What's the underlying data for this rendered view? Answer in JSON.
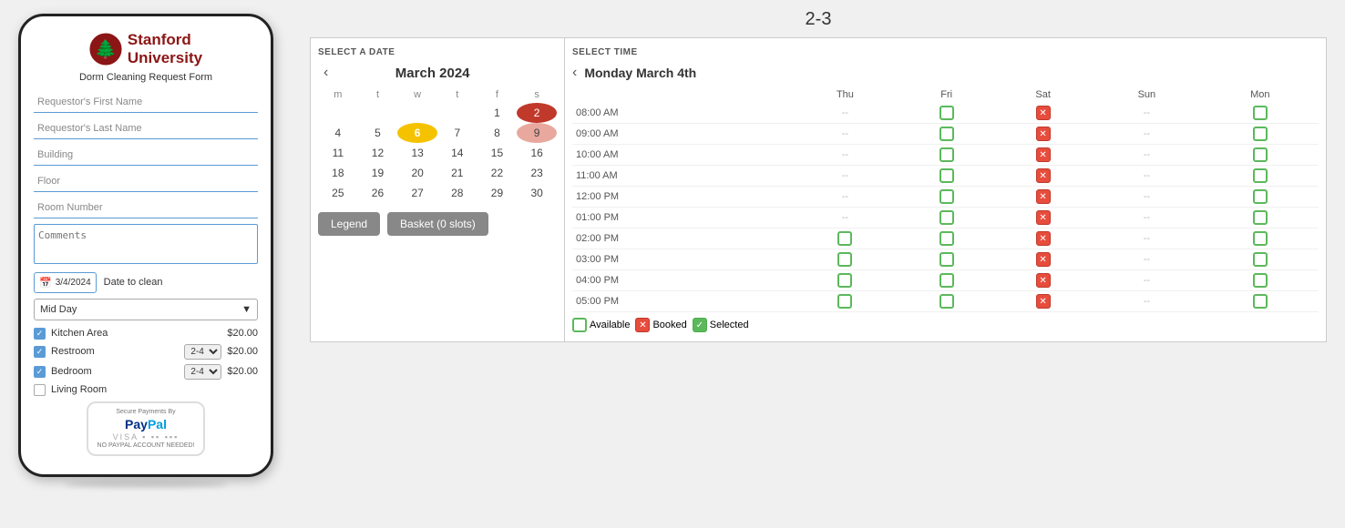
{
  "page": {
    "top_label": "2-3"
  },
  "phone": {
    "university_name": "Stanford\nUniversity",
    "form_title": "Dorm Cleaning Request Form",
    "fields": {
      "first_name_placeholder": "Requestor's First Name",
      "last_name_placeholder": "Requestor's Last Name",
      "building_placeholder": "Building",
      "floor_placeholder": "Floor",
      "room_placeholder": "Room Number",
      "comments_placeholder": "Comments"
    },
    "date_value": "3/4/2024",
    "date_label": "Date to clean",
    "dropdown_value": "Mid Day",
    "checkboxes": [
      {
        "label": "Kitchen Area",
        "checked": true,
        "has_select": false,
        "price": "$20.00"
      },
      {
        "label": "Restroom",
        "checked": true,
        "has_select": true,
        "select_val": "2-4",
        "price": "$20.00"
      },
      {
        "label": "Bedroom",
        "checked": true,
        "has_select": true,
        "select_val": "2-4",
        "price": "$20.00"
      },
      {
        "label": "Living Room",
        "checked": false,
        "has_select": false,
        "price": ""
      }
    ],
    "paypal": {
      "top_text": "Secure Payments By",
      "logo_text": "PayPal",
      "cards_text": "VISA ◼ ◼ ◼",
      "bottom_text": "NO PAYPAL ACCOUNT NEEDED!"
    }
  },
  "calendar": {
    "section_label": "SELECT A DATE",
    "month": "March 2024",
    "days_header": [
      "m",
      "t",
      "w",
      "t",
      "f",
      "s"
    ],
    "weeks": [
      [
        null,
        null,
        null,
        null,
        1,
        2
      ],
      [
        4,
        5,
        6,
        7,
        8,
        9
      ],
      [
        11,
        12,
        13,
        14,
        15,
        16
      ],
      [
        18,
        19,
        20,
        21,
        22,
        23
      ],
      [
        25,
        26,
        27,
        28,
        29,
        30
      ]
    ],
    "selected_day": 2,
    "today_day": 6,
    "pink_day": 9,
    "legend_btn": "Legend",
    "basket_btn": "Basket (0 slots)"
  },
  "time_picker": {
    "section_label": "SELECT TIME",
    "date_title": "Monday March 4th",
    "columns": [
      "Thu",
      "Fri",
      "Sat",
      "Sun",
      "Mon"
    ],
    "rows": [
      {
        "time": "08:00 AM",
        "thu": "--",
        "fri": "avail",
        "sat": "booked",
        "sun": "--",
        "mon": "avail"
      },
      {
        "time": "09:00 AM",
        "thu": "--",
        "fri": "avail",
        "sat": "booked",
        "sun": "--",
        "mon": "avail"
      },
      {
        "time": "10:00 AM",
        "thu": "--",
        "fri": "avail",
        "sat": "booked",
        "sun": "--",
        "mon": "avail"
      },
      {
        "time": "11:00 AM",
        "thu": "--",
        "fri": "avail",
        "sat": "booked",
        "sun": "--",
        "mon": "avail"
      },
      {
        "time": "12:00 PM",
        "thu": "--",
        "fri": "avail",
        "sat": "booked",
        "sun": "--",
        "mon": "avail"
      },
      {
        "time": "01:00 PM",
        "thu": "--",
        "fri": "avail",
        "sat": "booked",
        "sun": "--",
        "mon": "avail"
      },
      {
        "time": "02:00 PM",
        "thu": "avail",
        "fri": "avail",
        "sat": "booked",
        "sun": "--",
        "mon": "avail"
      },
      {
        "time": "03:00 PM",
        "thu": "avail",
        "fri": "avail",
        "sat": "booked",
        "sun": "--",
        "mon": "avail"
      },
      {
        "time": "04:00 PM",
        "thu": "avail",
        "fri": "avail",
        "sat": "booked",
        "sun": "--",
        "mon": "avail"
      },
      {
        "time": "05:00 PM",
        "thu": "avail",
        "fri": "avail",
        "sat": "booked",
        "sun": "--",
        "mon": "avail"
      }
    ],
    "legend": {
      "available_label": "Available",
      "booked_label": "Booked",
      "selected_label": "Selected"
    }
  }
}
